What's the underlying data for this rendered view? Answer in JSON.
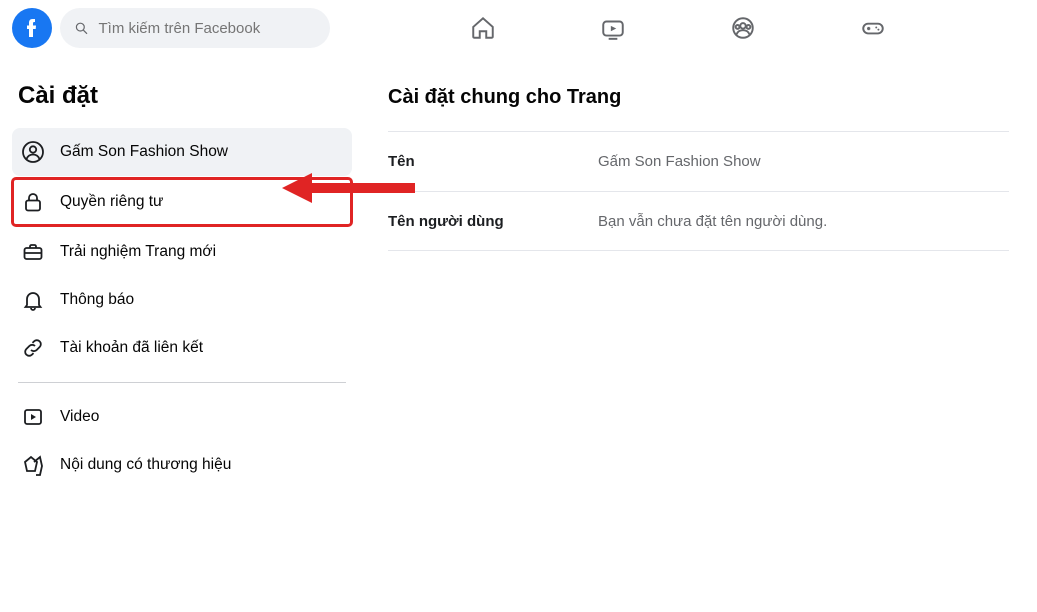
{
  "search": {
    "placeholder": "Tìm kiếm trên Facebook"
  },
  "sidebar": {
    "title": "Cài đặt",
    "items": [
      {
        "label": "Gấm Son Fashion Show"
      },
      {
        "label": "Quyền riêng tư"
      },
      {
        "label": "Trải nghiệm Trang mới"
      },
      {
        "label": "Thông báo"
      },
      {
        "label": "Tài khoản đã liên kết"
      },
      {
        "label": "Video"
      },
      {
        "label": "Nội dung có thương hiệu"
      }
    ]
  },
  "main": {
    "heading": "Cài đặt chung cho Trang",
    "rows": [
      {
        "label": "Tên",
        "value": "Gấm Son Fashion Show"
      },
      {
        "label": "Tên người dùng",
        "value": "Bạn vẫn chưa đặt tên người dùng."
      }
    ]
  },
  "annotation": {
    "arrow_color": "#e02424"
  }
}
